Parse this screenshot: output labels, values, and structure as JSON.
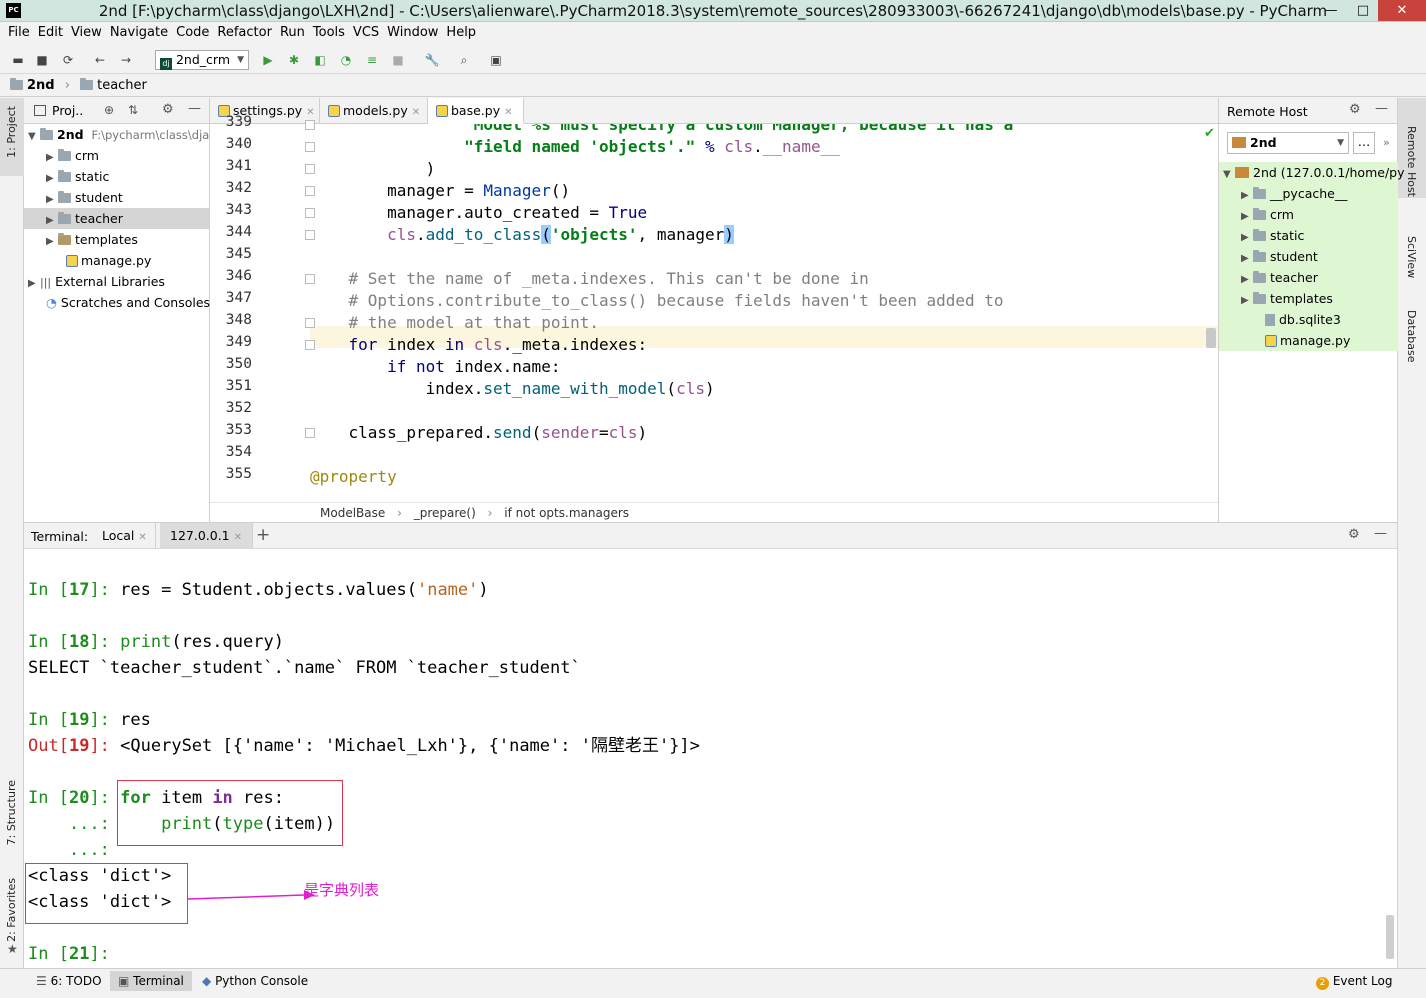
{
  "window": {
    "title": "2nd [F:\\pycharm\\class\\django\\LXH\\2nd] - C:\\Users\\alienware\\.PyCharm2018.3\\system\\remote_sources\\280933003\\-66267241\\django\\db\\models\\base.py - PyCharm",
    "app_icon_text": "PC",
    "minimize": "—",
    "maximize": "□",
    "close": "✕"
  },
  "menu": [
    "File",
    "Edit",
    "View",
    "Navigate",
    "Code",
    "Refactor",
    "Run",
    "Tools",
    "VCS",
    "Window",
    "Help"
  ],
  "toolbar": {
    "run_config": "2nd_crm"
  },
  "nav": {
    "project": "2nd",
    "folder": "teacher"
  },
  "left_strip": {
    "project": "1: Project",
    "structure": "7: Structure",
    "favorites": "2: Favorites"
  },
  "right_strip": {
    "remote_host": "Remote Host",
    "sciview": "SciView",
    "database": "Database"
  },
  "project_panel": {
    "title": "Proj..",
    "root_name": "2nd",
    "root_path": "F:\\pycharm\\class\\dja",
    "items": [
      {
        "label": "crm"
      },
      {
        "label": "static"
      },
      {
        "label": "student"
      },
      {
        "label": "teacher"
      },
      {
        "label": "templates"
      },
      {
        "label": "manage.py"
      }
    ],
    "external": "External Libraries",
    "scratches": "Scratches and Consoles"
  },
  "editor": {
    "tabs": [
      {
        "label": "settings.py"
      },
      {
        "label": "models.py"
      },
      {
        "label": "base.py"
      }
    ],
    "line_numbers": [
      "339",
      "340",
      "341",
      "342",
      "343",
      "344",
      "345",
      "346",
      "347",
      "348",
      "349",
      "350",
      "351",
      "352",
      "353",
      "354",
      "355"
    ],
    "breadcrumb": [
      "ModelBase",
      "_prepare()",
      "if not opts.managers"
    ]
  },
  "remote_host": {
    "title": "Remote Host",
    "server": "2nd",
    "root": "2nd (127.0.0.1/home/py",
    "items": [
      {
        "label": "__pycache__",
        "folder": true
      },
      {
        "label": "crm",
        "folder": true
      },
      {
        "label": "static",
        "folder": true
      },
      {
        "label": "student",
        "folder": true
      },
      {
        "label": "teacher",
        "folder": true
      },
      {
        "label": "templates",
        "folder": true
      },
      {
        "label": "db.sqlite3",
        "folder": false
      },
      {
        "label": "manage.py",
        "folder": false
      }
    ]
  },
  "terminal": {
    "label": "Terminal:",
    "tabs": [
      "Local",
      "127.0.0.1"
    ],
    "add": "+",
    "annotation": "是字典列表"
  },
  "statusbar": {
    "todo": "6: TODO",
    "terminal": "Terminal",
    "python_console": "Python Console",
    "event_count": "2",
    "event_log": "Event Log"
  },
  "colors": {
    "highlight_line": "#fbf6dd",
    "remote_selection": "#dff6d3",
    "annotation_red": "#e0344a",
    "annotation_magenta": "#e020d0"
  }
}
